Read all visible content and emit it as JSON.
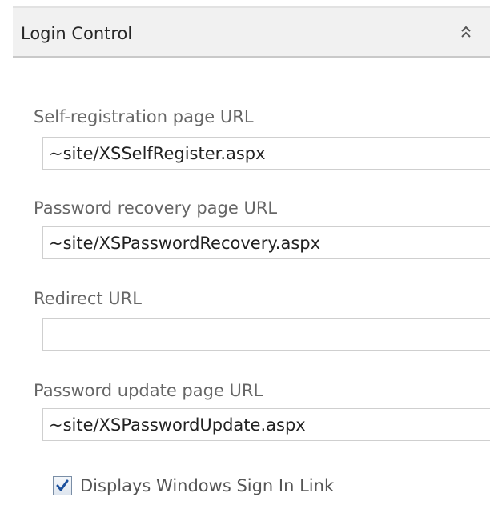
{
  "panel": {
    "title": "Login Control",
    "collapse_icon": "double-chevron-up-icon"
  },
  "fields": [
    {
      "label": "Self-registration page URL",
      "value": "~site/XSSelfRegister.aspx",
      "placeholder": ""
    },
    {
      "label": "Password recovery page URL",
      "value": "~site/XSPasswordRecovery.aspx",
      "placeholder": ""
    },
    {
      "label": "Redirect URL",
      "value": "",
      "placeholder": ""
    },
    {
      "label": "Password update page URL",
      "value": "~site/XSPasswordUpdate.aspx",
      "placeholder": ""
    }
  ],
  "windows_sign_in": {
    "label": "Displays Windows Sign In Link",
    "checked": true
  },
  "colors": {
    "header_bg": "#f1f1f1",
    "label_text": "#666666",
    "checkmark": "#1a4f9c"
  }
}
